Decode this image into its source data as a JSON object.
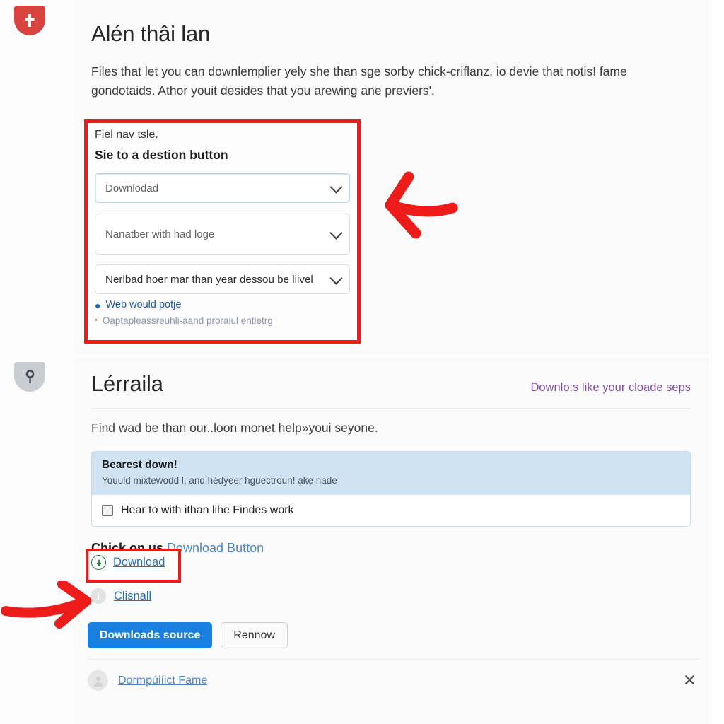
{
  "rail": {
    "items": [
      {
        "icon": "shield-plus-icon",
        "color": "#d8433f"
      },
      {
        "icon": "shield-key-icon",
        "color": "#c9cdd1"
      }
    ]
  },
  "top_panel": {
    "title": "Alén thâi lan",
    "lead": "Files that let you can downlemplier yely she than sge sorby chick-criflanz, io devie that notis! fame gondotaids. Athor youit desides that you arewing ane previers'.",
    "form": {
      "caption": "Fiel nav tsle.",
      "heading": "Sie to a destion button",
      "selects": [
        {
          "value": "Downlodad",
          "state": "placeholder-focused"
        },
        {
          "value": "Nanatber with had loge",
          "state": "placeholder"
        },
        {
          "value": "Nerlbad hoer mar than year dessou be liivel",
          "state": "value"
        }
      ],
      "bullets": [
        {
          "marker": "●",
          "text": "Web would potje",
          "color": "#1e56a0"
        },
        {
          "marker": "•",
          "text": "Oaptapleassreuhli-aand proraiul entletrg",
          "color": "#8f93aa"
        }
      ]
    }
  },
  "bottom_panel": {
    "title": "Lérraila",
    "head_link": "Downlo:s like your cloade seps",
    "lead": "Find wad be than our..loon monet help»youi seyone.",
    "infobox": {
      "title": "Bearest down!",
      "subtitle": "Youuld mixtewodd l; and hédyeer hguectroun! ake nade",
      "checkbox_label": "Hear to with ithan lihe Findes work",
      "checkbox_checked": false
    },
    "chick_prefix": "Chick on us ",
    "chick_link": "Download Button",
    "download_link": "Download",
    "download_icon": "download-circle-icon",
    "clisnall_link": "Clisnall",
    "clisnall_icon": "info-circle-icon",
    "buttons": {
      "primary": "Downloads source",
      "secondary": "Rennow"
    },
    "footer": {
      "avatar_icon": "avatar-icon",
      "link": "Dormpúiíict Fame",
      "close_icon": "close-icon",
      "close_glyph": "✕"
    }
  },
  "annotations": {
    "arrow_top": "red-left-arrow",
    "arrow_bottom": "red-right-arrow",
    "highlight_color": "#ee1b1b"
  }
}
